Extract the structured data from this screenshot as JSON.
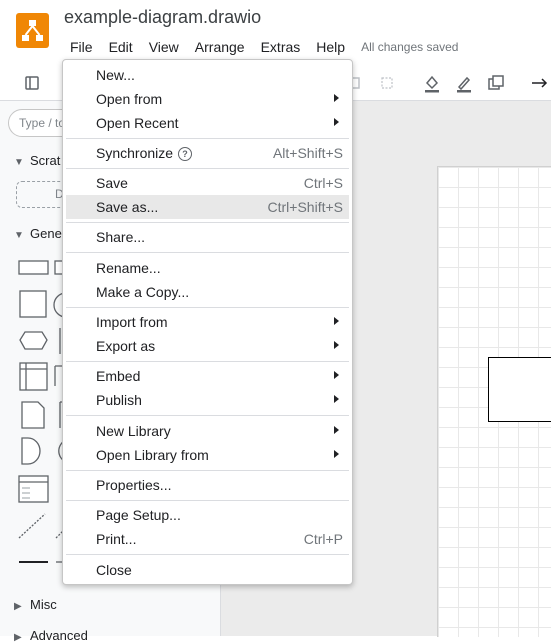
{
  "app": {
    "title": "example-diagram.drawio",
    "status": "All changes saved"
  },
  "menubar": [
    {
      "label": "File"
    },
    {
      "label": "Edit"
    },
    {
      "label": "View"
    },
    {
      "label": "Arrange"
    },
    {
      "label": "Extras"
    },
    {
      "label": "Help"
    }
  ],
  "sidebar": {
    "search_placeholder": "Type / to",
    "sections": {
      "scratchpad": "Scrat",
      "scratch_drop": "D",
      "general": "Gene",
      "misc": "Misc",
      "advanced": "Advanced"
    }
  },
  "file_menu": {
    "items": {
      "new": {
        "label": "New..."
      },
      "open_from": {
        "label": "Open from"
      },
      "open_recent": {
        "label": "Open Recent"
      },
      "synchronize": {
        "label": "Synchronize",
        "shortcut": "Alt+Shift+S"
      },
      "save": {
        "label": "Save",
        "shortcut": "Ctrl+S"
      },
      "save_as": {
        "label": "Save as...",
        "shortcut": "Ctrl+Shift+S"
      },
      "share": {
        "label": "Share..."
      },
      "rename": {
        "label": "Rename..."
      },
      "make_copy": {
        "label": "Make a Copy..."
      },
      "import_from": {
        "label": "Import from"
      },
      "export_as": {
        "label": "Export as"
      },
      "embed": {
        "label": "Embed"
      },
      "publish": {
        "label": "Publish"
      },
      "new_library": {
        "label": "New Library"
      },
      "open_library_from": {
        "label": "Open Library from"
      },
      "properties": {
        "label": "Properties..."
      },
      "page_setup": {
        "label": "Page Setup..."
      },
      "print": {
        "label": "Print...",
        "shortcut": "Ctrl+P"
      },
      "close": {
        "label": "Close"
      }
    },
    "help_glyph": "?"
  },
  "colors": {
    "brand": "#f08705",
    "highlight": "#e8e8e8",
    "canvas": "#ebebeb"
  },
  "icons": [
    "drawio-logo-icon",
    "format-panel-icon",
    "fill-color-icon",
    "line-color-icon",
    "shadow-icon",
    "connector-arrow-icon",
    "help-circle-icon",
    "submenu-arrow-icon"
  ]
}
